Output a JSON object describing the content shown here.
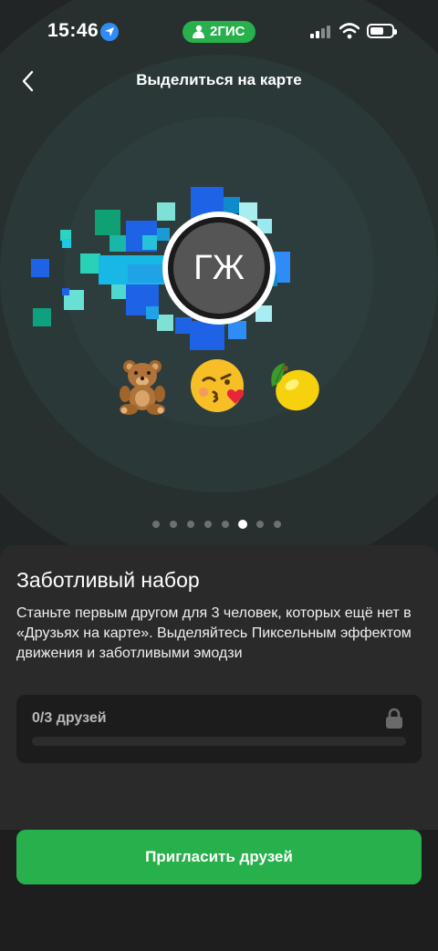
{
  "status_bar": {
    "time": "15:46",
    "app_pill": "2ГИС"
  },
  "header": {
    "title": "Выделиться на карте"
  },
  "avatar": {
    "initials": "ГЖ"
  },
  "emojis": [
    "🧸",
    "😘",
    "🍋"
  ],
  "pager": {
    "count": 8,
    "active": 5
  },
  "card": {
    "title": "Заботливый набор",
    "description": "Станьте первым другом для 3 человек, которых ещё нет в «Друзьях на карте». Выделяйтесь Пиксельным эффектом движения и заботливыми эмодзи",
    "progress_label": "0/3 друзей",
    "progress_fraction": 0
  },
  "cta": {
    "label": "Пригласить друзей"
  },
  "colors": {
    "accent": "#27b04b",
    "sheet": "#2a2a2a",
    "pixel_blue": "#1e62e6",
    "pixel_cyan": "#1cc8e6",
    "pixel_teal": "#0fa080"
  }
}
